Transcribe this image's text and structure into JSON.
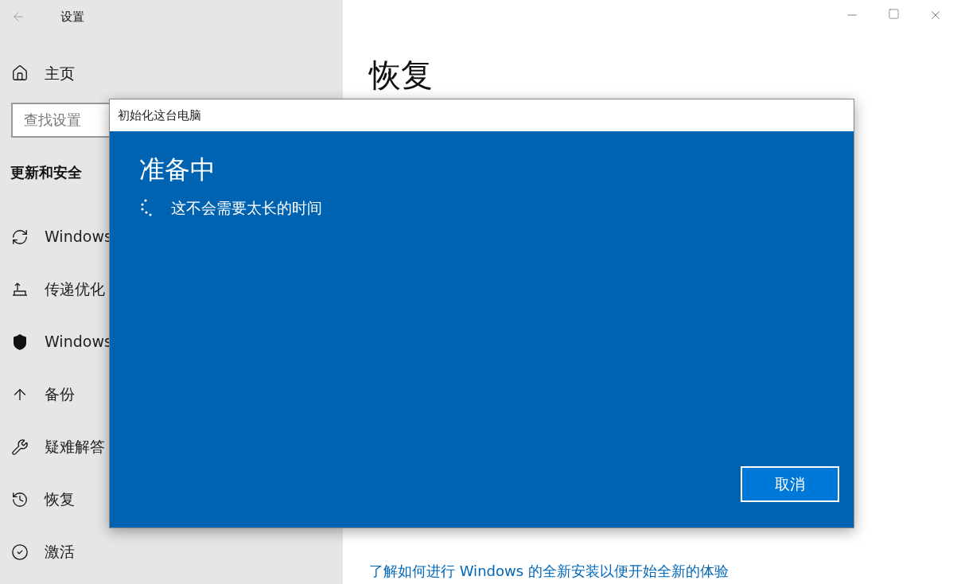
{
  "window": {
    "title": "设置"
  },
  "sidebar": {
    "home": "主页",
    "search": {
      "placeholder": "查找设置"
    },
    "section": "更新和安全",
    "items": [
      {
        "kind": "sync",
        "label": "Windows"
      },
      {
        "kind": "delivery",
        "label": "传递优化"
      },
      {
        "kind": "shield",
        "label": "Windows"
      },
      {
        "kind": "backup",
        "label": "备份"
      },
      {
        "kind": "wrench",
        "label": "疑难解答"
      },
      {
        "kind": "history",
        "label": "恢复"
      },
      {
        "kind": "check",
        "label": "激活"
      }
    ]
  },
  "content": {
    "title": "恢复",
    "link": "了解如何进行 Windows 的全新安装以便开始全新的体验"
  },
  "dialog": {
    "title": "初始化这台电脑",
    "heading": "准备中",
    "message": "这不会需要太长的时间",
    "cancel": "取消"
  }
}
